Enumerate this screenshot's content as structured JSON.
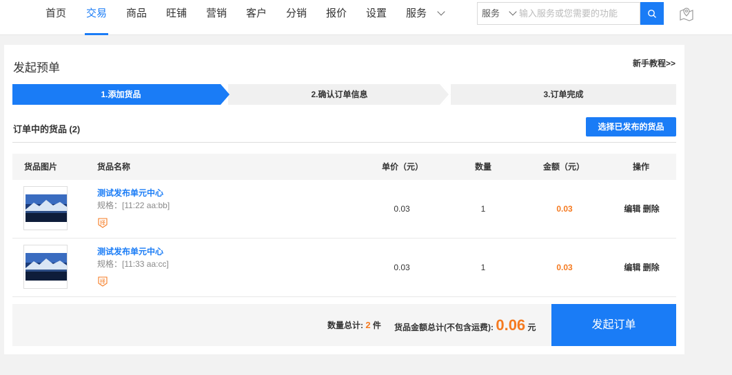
{
  "nav": {
    "items": [
      {
        "label": "首页"
      },
      {
        "label": "交易"
      },
      {
        "label": "商品"
      },
      {
        "label": "旺铺"
      },
      {
        "label": "营销"
      },
      {
        "label": "客户"
      },
      {
        "label": "分销"
      },
      {
        "label": "报价"
      },
      {
        "label": "设置"
      },
      {
        "label": "服务"
      }
    ],
    "active": "交易",
    "search": {
      "scope": "服务",
      "placeholder": "输入服务或您需要的功能",
      "value": ""
    }
  },
  "page": {
    "title": "发起预单",
    "tutorial_link": "新手教程>>"
  },
  "steps": [
    {
      "label": "1.添加货品",
      "active": true
    },
    {
      "label": "2.确认订单信息",
      "active": false
    },
    {
      "label": "3.订单完成",
      "active": false
    }
  ],
  "goods": {
    "heading": "订单中的货品",
    "count_text": "(2)",
    "select_button": "选择已发布的货品"
  },
  "table": {
    "headers": {
      "image": "货品图片",
      "name": "货品名称",
      "price": "单价（元）",
      "qty": "数量",
      "amount": "金额（元）",
      "ops": "操作"
    },
    "rows": [
      {
        "name": "测试发布单元中心",
        "spec": "规格：[11:22 aa:bb]",
        "price": "0.03",
        "qty": "1",
        "amount": "0.03",
        "edit": "编辑",
        "delete": "删除"
      },
      {
        "name": "测试发布单元中心",
        "spec": "规格：[11:33 aa:cc]",
        "price": "0.03",
        "qty": "1",
        "amount": "0.03",
        "edit": "编辑",
        "delete": "删除"
      }
    ]
  },
  "footer": {
    "qty_label": "数量总计:",
    "qty_value": "2",
    "qty_unit": "件",
    "amount_label": "货品金额总计(不包含运费):",
    "amount_value": "0.06",
    "amount_unit": "元",
    "submit_button": "发起订单"
  },
  "colors": {
    "accent": "#1a7cf6",
    "price_highlight": "#f57a20"
  },
  "icons": [
    "chevron-down-icon",
    "search-icon",
    "map-pin-icon",
    "select-tag-icon"
  ]
}
